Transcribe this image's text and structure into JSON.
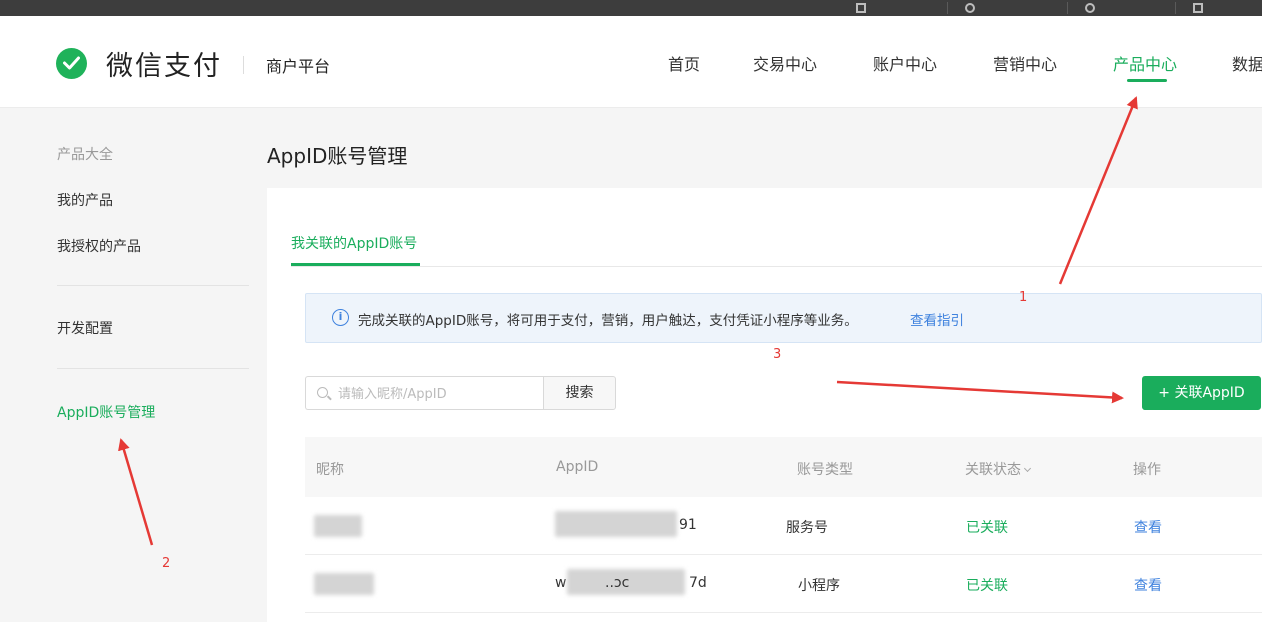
{
  "header": {
    "brand": "微信支付",
    "platform": "商户平台",
    "nav": [
      {
        "label": "首页",
        "active": false
      },
      {
        "label": "交易中心",
        "active": false
      },
      {
        "label": "账户中心",
        "active": false
      },
      {
        "label": "营销中心",
        "active": false
      },
      {
        "label": "产品中心",
        "active": true
      },
      {
        "label": "数据",
        "active": false
      }
    ]
  },
  "sidebar": {
    "items": [
      {
        "label": "产品大全",
        "muted": true
      },
      {
        "label": "我的产品"
      },
      {
        "label": "我授权的产品"
      },
      {
        "label": "开发配置"
      },
      {
        "label": "AppID账号管理",
        "active": true
      }
    ]
  },
  "main": {
    "title": "AppID账号管理",
    "tab": "我关联的AppID账号",
    "notice": {
      "icon": "info-icon",
      "text": "完成关联的AppID账号，将可用于支付，营销，用户触达，支付凭证小程序等业务。",
      "link": "查看指引"
    },
    "search": {
      "placeholder": "请输入昵称/AppID",
      "button": "搜索"
    },
    "add_button": "+ 关联AppID",
    "table": {
      "columns": [
        "昵称",
        "AppID",
        "账号类型",
        "关联状态",
        "操作"
      ],
      "rows": [
        {
          "appid_suffix": "91",
          "type": "服务号",
          "status": "已关联",
          "action": "查看"
        },
        {
          "appid_prefix": "w",
          "appid_middle": "..ɔc",
          "appid_suffix": "7d",
          "type": "小程序",
          "status": "已关联",
          "action": "查看"
        }
      ]
    }
  },
  "annotations": [
    "1",
    "2",
    "3"
  ],
  "colors": {
    "accent": "#1aad5c",
    "link": "#3f82de",
    "annotation": "#e53935",
    "topbar": "#3d3d3d"
  }
}
